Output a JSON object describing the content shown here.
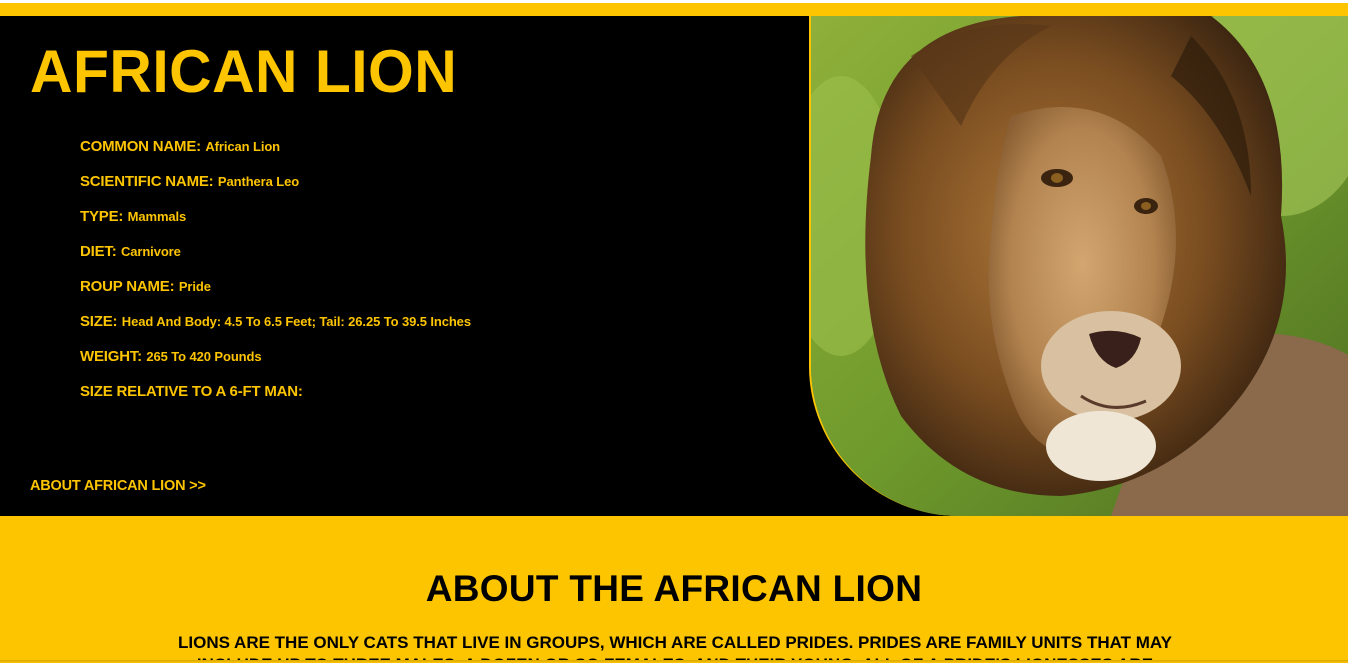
{
  "hero": {
    "title": "AFRICAN LION",
    "facts": [
      {
        "label": "COMMON NAME:",
        "value": "African Lion"
      },
      {
        "label": "SCIENTIFIC NAME:",
        "value": "Panthera Leo"
      },
      {
        "label": "TYPE:",
        "value": "Mammals"
      },
      {
        "label": "DIET:",
        "value": "Carnivore"
      },
      {
        "label": "ROUP NAME:",
        "value": "Pride"
      },
      {
        "label": "SIZE:",
        "value": "Head And Body: 4.5 To 6.5 Feet; Tail: 26.25 To 39.5 Inches"
      },
      {
        "label": "WEIGHT:",
        "value": "265 To 420 Pounds"
      },
      {
        "label": "SIZE RELATIVE TO A 6-FT MAN:",
        "value": ""
      }
    ],
    "about_link": "ABOUT AFRICAN LION >>"
  },
  "about": {
    "heading": "ABOUT THE AFRICAN LION",
    "text": "Lions are the only cats that live in groups, which are called prides. Prides are family units that may include up to three males, a dozen or so females, and their young. All of a pride's lionesses are"
  },
  "colors": {
    "accent": "#fdc400",
    "background": "#000000",
    "text_dark": "#000000"
  }
}
